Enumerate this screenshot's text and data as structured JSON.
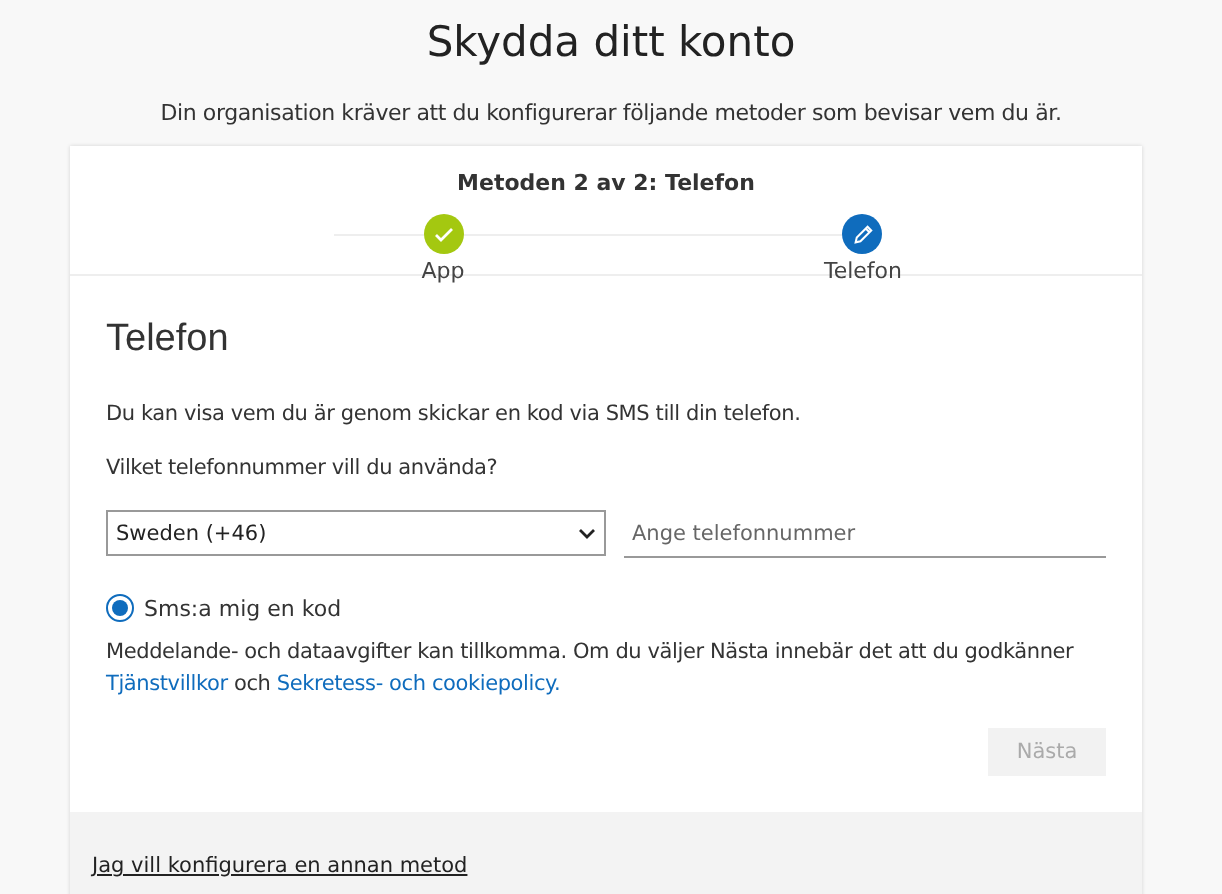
{
  "title": "Skydda ditt konto",
  "subtitle": "Din organisation kräver att du konfigurerar följande metoder som bevisar vem du är.",
  "progress": {
    "heading": "Metoden 2 av 2: Telefon",
    "steps": [
      {
        "label": "App",
        "completed": true
      },
      {
        "label": "Telefon",
        "completed": false
      }
    ]
  },
  "method": {
    "heading": "Telefon",
    "description": "Du kan visa vem du är genom skickar en kod via SMS till din telefon.",
    "question": "Vilket telefonnummer vill du använda?",
    "country": {
      "value": "Sweden (+46)"
    },
    "phone": {
      "placeholder": "Ange telefonnummer"
    },
    "options": [
      {
        "label": "Sms:a mig en kod",
        "selected": true
      }
    ],
    "notice": [
      {
        "kind": "text",
        "text": "Meddelande- och dataavgifter kan tillkomma. Om du väljer Nästa innebär det att du godkänner "
      },
      {
        "kind": "link",
        "text": "Tjänstvillkor"
      },
      {
        "kind": "text",
        "text": " och "
      },
      {
        "kind": "link",
        "text": "Sekretess- och cookiepolicy."
      }
    ],
    "next_button": {
      "label": "Nästa",
      "disabled": true
    }
  },
  "footer": {
    "link": "Jag vill konfigurera en annan metod"
  }
}
